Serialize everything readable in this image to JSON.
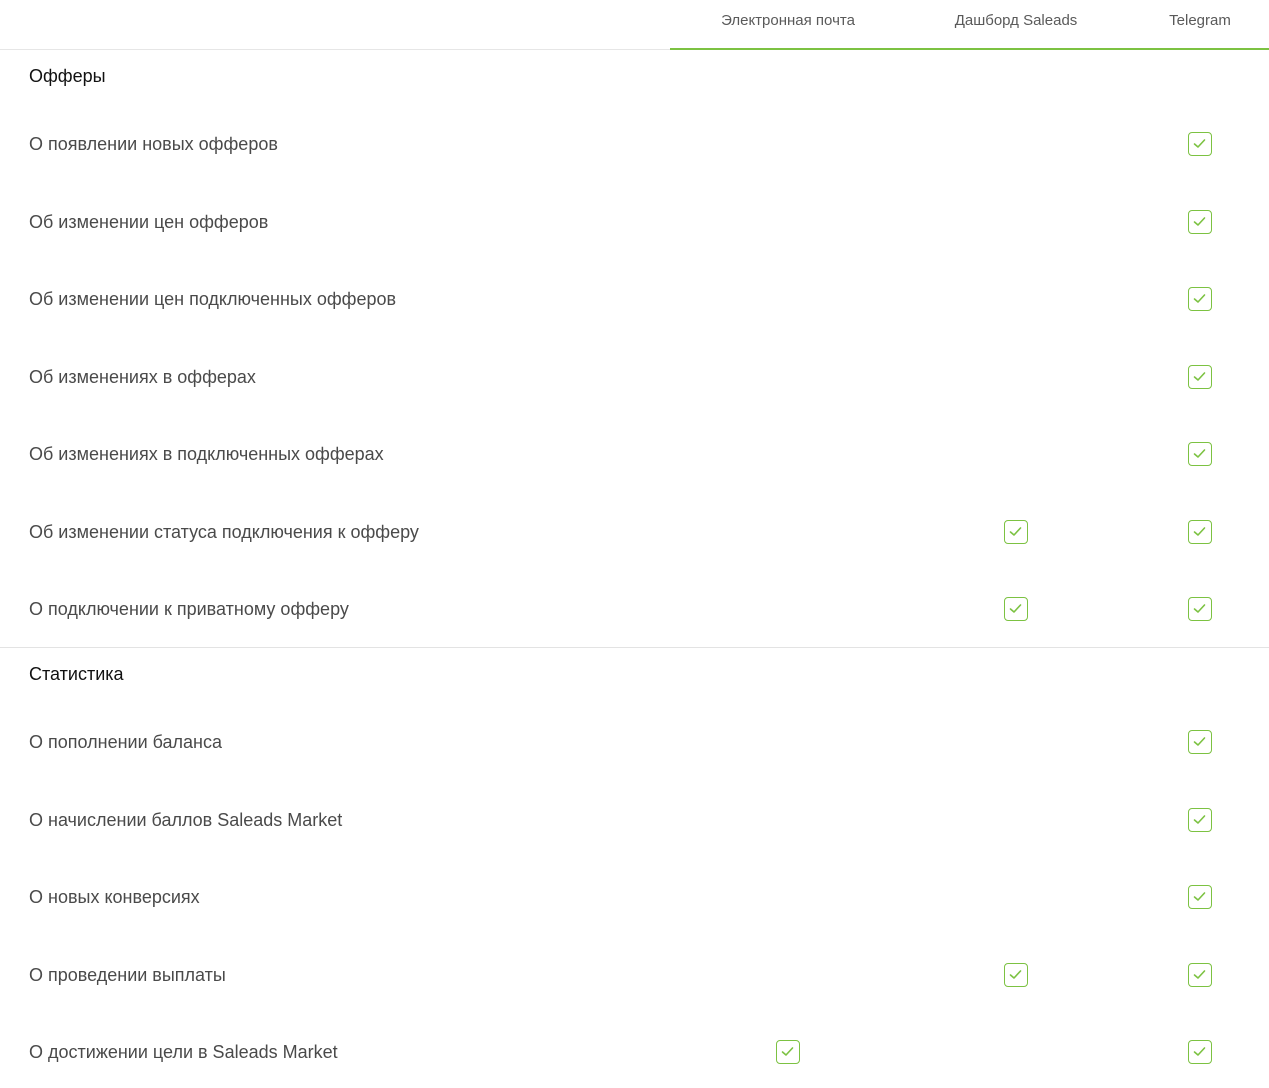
{
  "columns": [
    {
      "label": "Электронная почта"
    },
    {
      "label": "Дашборд Saleads"
    },
    {
      "label": "Telegram"
    }
  ],
  "colors": {
    "accent": "#7cc242",
    "divider": "#e3e3e3"
  },
  "sections": [
    {
      "title": "Офферы",
      "rows": [
        {
          "label": "О появлении новых офферов",
          "email": false,
          "dashboard": false,
          "telegram": true
        },
        {
          "label": "Об изменении цен офферов",
          "email": false,
          "dashboard": false,
          "telegram": true
        },
        {
          "label": "Об изменении цен подключенных офферов",
          "email": false,
          "dashboard": false,
          "telegram": true
        },
        {
          "label": "Об изменениях в офферах",
          "email": false,
          "dashboard": false,
          "telegram": true
        },
        {
          "label": "Об изменениях в подключенных офферах",
          "email": false,
          "dashboard": false,
          "telegram": true
        },
        {
          "label": "Об изменении статуса подключения к офферу",
          "email": false,
          "dashboard": true,
          "telegram": true
        },
        {
          "label": "О подключении к приватному офферу",
          "email": false,
          "dashboard": true,
          "telegram": true
        }
      ]
    },
    {
      "title": "Статистика",
      "rows": [
        {
          "label": "О пополнении баланса",
          "email": false,
          "dashboard": false,
          "telegram": true
        },
        {
          "label": "О начислении баллов Saleads Market",
          "email": false,
          "dashboard": false,
          "telegram": true
        },
        {
          "label": "О новых конверсиях",
          "email": false,
          "dashboard": false,
          "telegram": true
        },
        {
          "label": "О проведении выплаты",
          "email": false,
          "dashboard": true,
          "telegram": true
        },
        {
          "label": "О достижении цели в Saleads Market",
          "email": true,
          "dashboard": false,
          "telegram": true
        }
      ]
    }
  ]
}
